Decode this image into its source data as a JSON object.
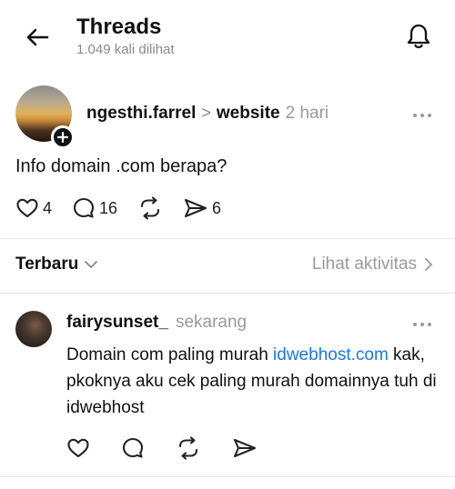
{
  "header": {
    "title": "Threads",
    "subtitle": "1.049 kali dilihat"
  },
  "post": {
    "username": "ngesthi.farrel",
    "separator": ">",
    "topic": "website",
    "time": "2 hari",
    "text": "Info domain .com berapa?",
    "likes": "4",
    "replies": "16",
    "shares": "6"
  },
  "sort": {
    "label": "Terbaru",
    "activity_label": "Lihat aktivitas"
  },
  "reply": {
    "username": "fairysunset_",
    "time": "sekarang",
    "text_before_link": "Domain com paling murah ",
    "link_text": "idwebhost.com",
    "text_after_link": " kak, pkoknya aku cek paling murah domainnya tuh di idwebhost"
  },
  "icons": {
    "back": "arrow-left-icon",
    "notifications": "bell-icon",
    "follow": "plus-icon",
    "more": "more-dots-icon",
    "like": "heart-icon",
    "comment": "comment-bubble-icon",
    "repost": "repost-icon",
    "share": "send-icon",
    "sort": "chevron-down-icon",
    "activity": "chevron-right-icon"
  },
  "colors": {
    "link": "#1877f2",
    "muted": "#8a8a8a",
    "divider": "#e6e6e6"
  }
}
